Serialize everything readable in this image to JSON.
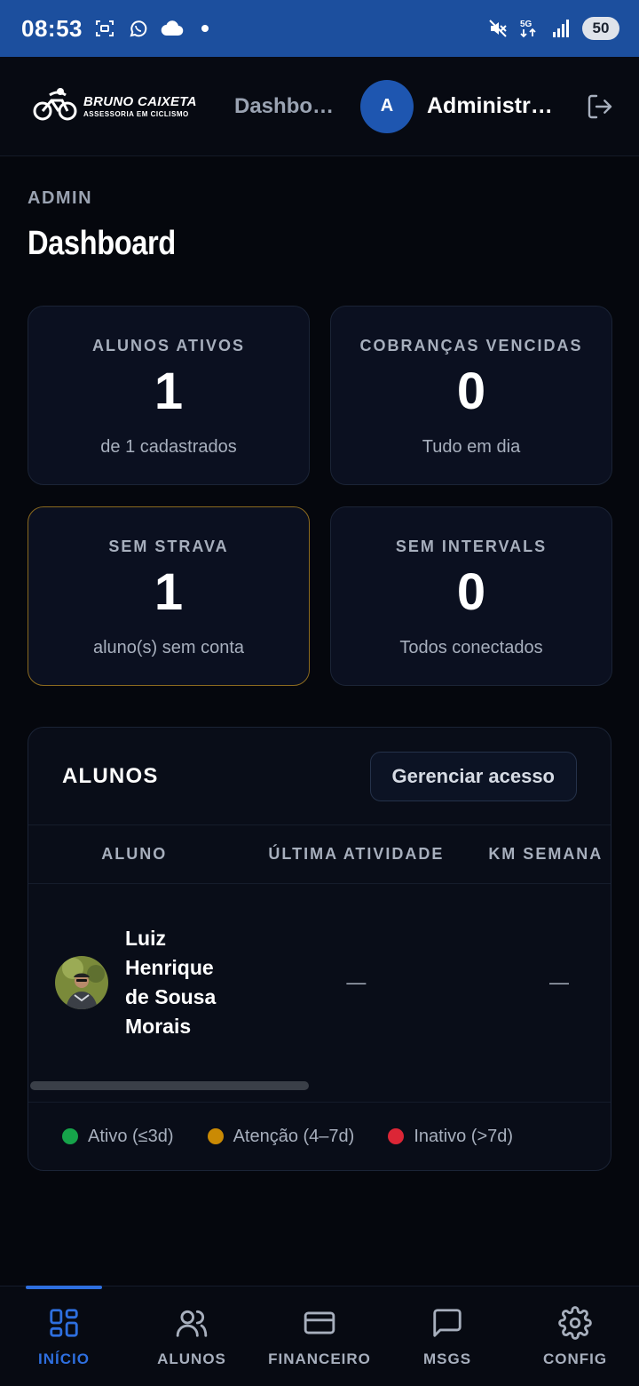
{
  "status_bar": {
    "time": "08:53",
    "network": "5G",
    "battery": "50"
  },
  "header": {
    "logo_name": "BRUNO CAIXETA",
    "logo_sub": "ASSESSORIA EM CICLISMO",
    "title": "Dashboard",
    "avatar_initial": "A",
    "user_name": "Administrador"
  },
  "page": {
    "eyebrow": "ADMIN",
    "title": "Dashboard"
  },
  "stats": [
    {
      "label": "ALUNOS ATIVOS",
      "value": "1",
      "sub": "de 1 cadastrados"
    },
    {
      "label": "COBRANÇAS VENCIDAS",
      "value": "0",
      "sub": "Tudo em dia"
    },
    {
      "label": "SEM STRAVA",
      "value": "1",
      "sub": "aluno(s) sem conta",
      "highlight_color": "#8b6a1f"
    },
    {
      "label": "SEM INTERVALS",
      "value": "0",
      "sub": "Todos conectados"
    }
  ],
  "alunos": {
    "title": "ALUNOS",
    "manage_button": "Gerenciar acesso",
    "columns": [
      "ALUNO",
      "ÚLTIMA ATIVIDADE",
      "KM SEMANA"
    ],
    "rows": [
      {
        "name": "Luiz Henrique de Sousa Morais",
        "last_activity": "—",
        "km_week": "—"
      }
    ],
    "legend": [
      {
        "label": "Ativo (≤3d)",
        "color": "#16a34a"
      },
      {
        "label": "Atenção (4–7d)",
        "color": "#ca8a04"
      },
      {
        "label": "Inativo (>7d)",
        "color": "#dc2636"
      }
    ]
  },
  "bottom_nav": {
    "accent": "#2e6fdf",
    "items": [
      {
        "label": "INÍCIO",
        "icon": "grid-icon",
        "active": true
      },
      {
        "label": "ALUNOS",
        "icon": "users-icon",
        "active": false
      },
      {
        "label": "FINANCEIRO",
        "icon": "card-icon",
        "active": false
      },
      {
        "label": "MSGS",
        "icon": "chat-icon",
        "active": false
      },
      {
        "label": "CONFIG",
        "icon": "gear-icon",
        "active": false
      }
    ]
  }
}
